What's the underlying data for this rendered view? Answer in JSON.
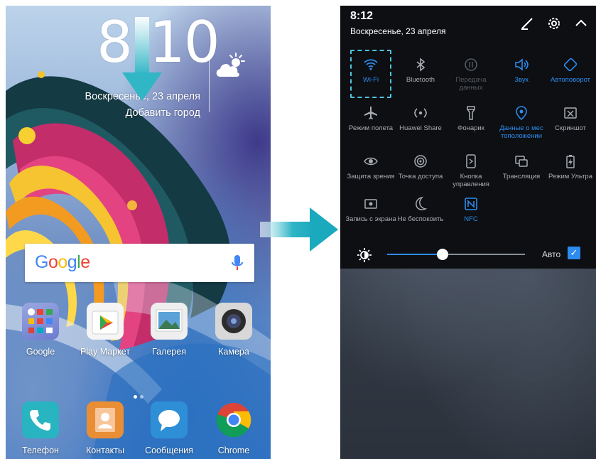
{
  "lockscreen": {
    "time_hour": "8",
    "time_colon": ":",
    "time_minutes": "10",
    "date": "Воскресенье, 23 апреля",
    "add_city": "Добавить город"
  },
  "search": {
    "logo": [
      "G",
      "o",
      "o",
      "g",
      "l",
      "e"
    ]
  },
  "apps_row1": [
    {
      "label": "Google"
    },
    {
      "label": "Play Маркет"
    },
    {
      "label": "Галерея"
    },
    {
      "label": "Камера"
    }
  ],
  "dock": [
    {
      "label": "Телефон"
    },
    {
      "label": "Контакты"
    },
    {
      "label": "Сообщения"
    },
    {
      "label": "Chrome"
    }
  ],
  "shade": {
    "time": "8:12",
    "date": "Воскресенье, 23 апреля",
    "tiles_row1": [
      {
        "label": "Wi-Fi",
        "icon": "wifi-icon",
        "state": "on"
      },
      {
        "label": "Bluetooth",
        "icon": "bluetooth-icon",
        "state": "off"
      },
      {
        "label": "Передача данных",
        "icon": "mobile-data-icon",
        "state": "dim"
      },
      {
        "label": "Звук",
        "icon": "sound-icon",
        "state": "on"
      },
      {
        "label": "Автоповорот",
        "icon": "auto-rotate-icon",
        "state": "on"
      }
    ],
    "tiles_row2": [
      {
        "label": "Режим полета",
        "icon": "airplane-icon",
        "state": "off"
      },
      {
        "label": "Huawei Share",
        "icon": "huawei-share-icon",
        "state": "off"
      },
      {
        "label": "Фонарик",
        "icon": "flashlight-icon",
        "state": "off"
      },
      {
        "label": "Данные о мес тоположении",
        "icon": "location-icon",
        "state": "on"
      },
      {
        "label": "Скриншот",
        "icon": "screenshot-icon",
        "state": "off"
      }
    ],
    "tiles_row3": [
      {
        "label": "Защита зрения",
        "icon": "eye-comfort-icon",
        "state": "off"
      },
      {
        "label": "Точка доступа",
        "icon": "hotspot-icon",
        "state": "off"
      },
      {
        "label": "Кнопка управления",
        "icon": "nav-button-icon",
        "state": "off"
      },
      {
        "label": "Трансляция",
        "icon": "cast-icon",
        "state": "off"
      },
      {
        "label": "Режим Ультра",
        "icon": "battery-icon",
        "state": "off"
      }
    ],
    "tiles_row4": [
      {
        "label": "Запись с экрана",
        "icon": "screen-record-icon",
        "state": "off"
      },
      {
        "label": "Не беспокоить",
        "icon": "moon-icon",
        "state": "off"
      },
      {
        "label": "NFC",
        "icon": "nfc-icon",
        "state": "on"
      }
    ],
    "brightness_level": 0.4,
    "auto_label": "Авто",
    "auto_checked": true
  },
  "colors": {
    "accent": "#2d8cf0",
    "highlight": "#4fc3e0",
    "shade_bg": "#0d0f12"
  }
}
